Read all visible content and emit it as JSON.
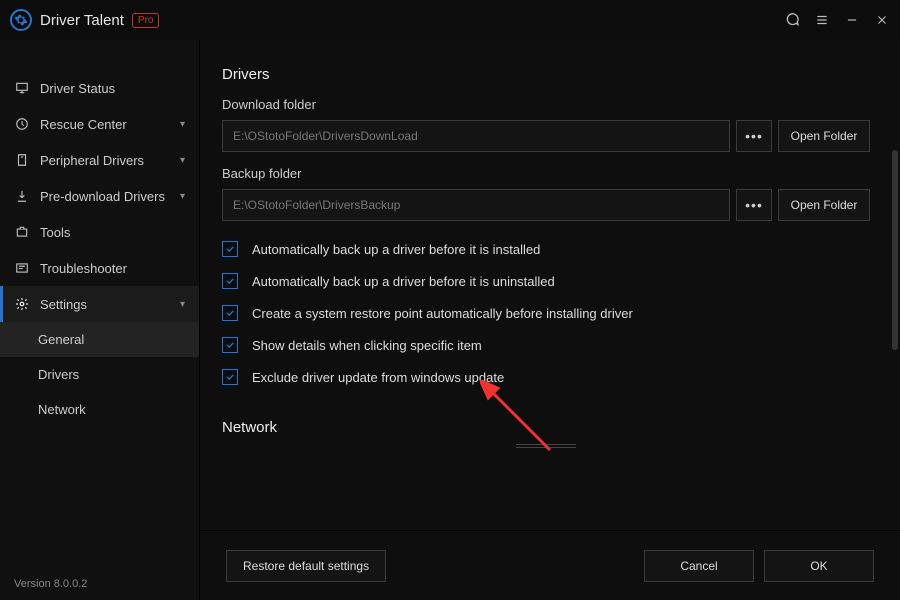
{
  "app": {
    "title": "Driver Talent",
    "pro_badge": "Pro",
    "version": "Version 8.0.0.2"
  },
  "sidebar": {
    "items": [
      {
        "label": "Driver Status",
        "has_chevron": false
      },
      {
        "label": "Rescue Center",
        "has_chevron": true
      },
      {
        "label": "Peripheral Drivers",
        "has_chevron": true
      },
      {
        "label": "Pre-download Drivers",
        "has_chevron": true
      },
      {
        "label": "Tools",
        "has_chevron": false
      },
      {
        "label": "Troubleshooter",
        "has_chevron": false
      },
      {
        "label": "Settings",
        "has_chevron": true
      }
    ],
    "settings_sub": [
      {
        "label": "General"
      },
      {
        "label": "Drivers"
      },
      {
        "label": "Network"
      }
    ]
  },
  "main": {
    "drivers_section": "Drivers",
    "download_folder_label": "Download folder",
    "download_folder_path": "E:\\OStotoFolder\\DriversDownLoad",
    "backup_folder_label": "Backup folder",
    "backup_folder_path": "E:\\OStotoFolder\\DriversBackup",
    "open_folder_label": "Open Folder",
    "checkboxes": [
      "Automatically back up a driver before it is installed",
      "Automatically back up a driver before it is uninstalled",
      "Create a system restore point automatically before installing driver",
      "Show details when clicking specific item",
      "Exclude driver update from windows update"
    ],
    "network_section": "Network"
  },
  "footer": {
    "restore": "Restore default settings",
    "cancel": "Cancel",
    "ok": "OK"
  }
}
